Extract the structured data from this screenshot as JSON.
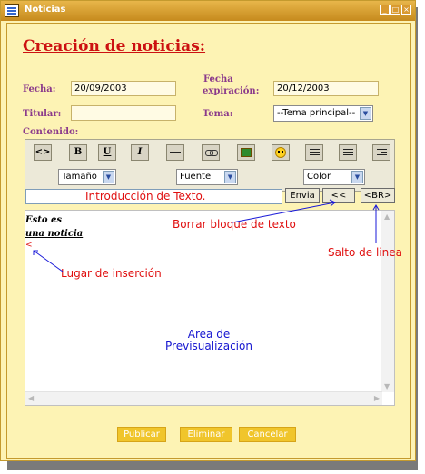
{
  "window": {
    "title": "Noticias"
  },
  "heading": "Creación de noticias:",
  "form": {
    "fecha_label": "Fecha:",
    "fecha_value": "20/09/2003",
    "fecha_exp_label_1": "Fecha",
    "fecha_exp_label_2": "expiración:",
    "fecha_exp_value": "20/12/2003",
    "titular_label": "Titular:",
    "titular_value": "",
    "tema_label": "Tema:",
    "tema_value": "--Tema principal--",
    "contenido_label": "Contenido:"
  },
  "toolbar": {
    "tag_label": "<>",
    "bold_label": "B",
    "underline_label": "U",
    "italic_label": "I",
    "size_select": "Tamaño",
    "font_select": "Fuente",
    "color_select": "Color"
  },
  "text_input": {
    "value": ""
  },
  "buttons": {
    "envia": "Envia",
    "back": "<<",
    "br": "<BR>"
  },
  "preview": {
    "line1": "Esto es",
    "line2": "una noticia",
    "caret": "<"
  },
  "annotations": {
    "intro": "Introducción de Texto.",
    "borrar": "Borrar bloque de texto",
    "salto": "Salto de linea",
    "lugar": "Lugar de inserción",
    "area_1": "Area de",
    "area_2": "Previsualización"
  },
  "actions": {
    "publicar": "Publicar",
    "eliminar": "Eliminar",
    "cancelar": "Cancelar"
  },
  "colors": {
    "background": "#fdf3b4",
    "accent": "#cc1111",
    "label": "#8b3a8b",
    "button": "#f0c52b",
    "annotation_red": "#e01010",
    "annotation_blue": "#1515d0"
  },
  "icons": [
    "app-icon",
    "minimize-icon",
    "maximize-icon",
    "close-icon",
    "source-tag-icon",
    "horizontal-rule-icon",
    "link-icon",
    "image-icon",
    "smiley-icon",
    "align-left-icon",
    "align-center-icon",
    "align-right-icon"
  ]
}
